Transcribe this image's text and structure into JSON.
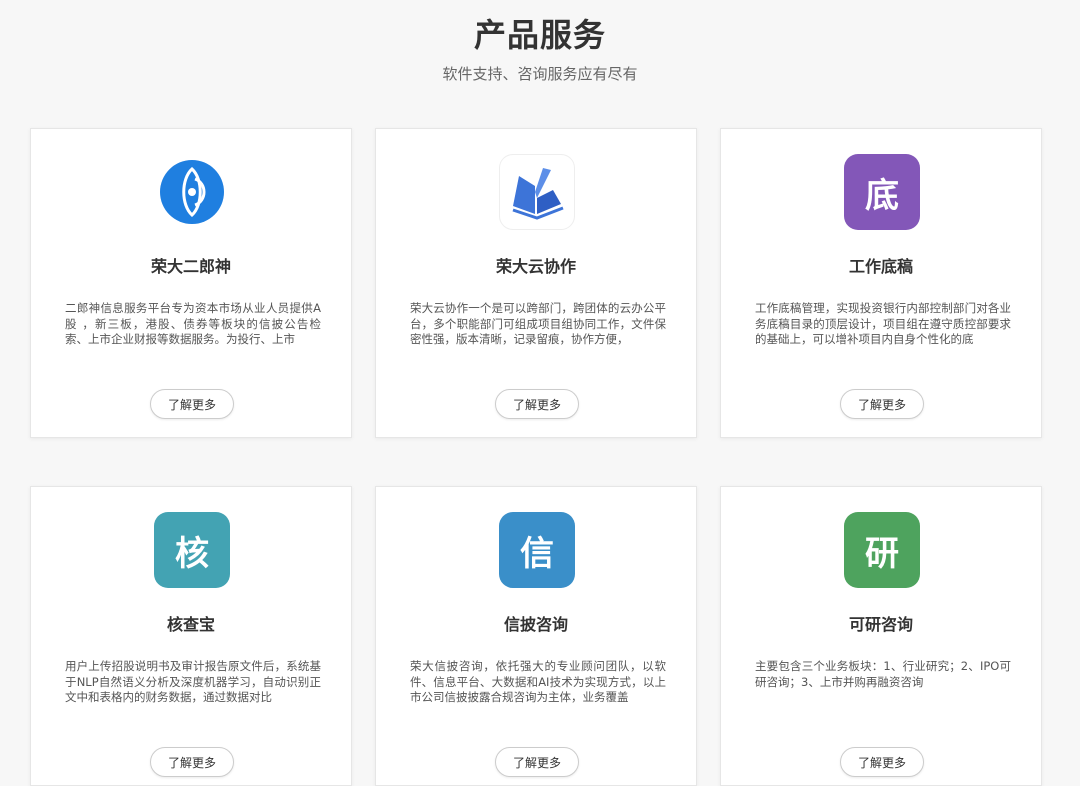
{
  "header": {
    "title": "产品服务",
    "subtitle": "软件支持、咨询服务应有尽有"
  },
  "cards": [
    {
      "name": "荣大二郎神",
      "icon": "eye-logo-icon",
      "desc": "二郎神信息服务平台专为资本市场从业人员提供A股 ，新三板，港股、债券等板块的信披公告检索、上市企业财报等数据服务。为投行、上市",
      "button": "了解更多",
      "color": "#1f7fe0"
    },
    {
      "name": "荣大云协作",
      "icon": "book-wings-icon",
      "desc": "荣大云协作一个是可以跨部门，跨团体的云办公平台，多个职能部门可组成项目组协同工作，文件保密性强，版本清晰，记录留痕，协作方便，",
      "button": "了解更多",
      "color": "#3d74d8"
    },
    {
      "name": "工作底稿",
      "icon_char": "底",
      "icon": "di-char-icon",
      "desc": "工作底稿管理，实现投资银行内部控制部门对各业务底稿目录的顶层设计，项目组在遵守质控部要求的基础上，可以增补项目内自身个性化的底",
      "button": "了解更多",
      "color": "#8357b8"
    },
    {
      "name": "核查宝",
      "icon_char": "核",
      "icon": "he-char-icon",
      "desc": "用户上传招股说明书及审计报告原文件后，系统基于NLP自然语义分析及深度机器学习，自动识别正文中和表格内的财务数据，通过数据对比",
      "button": "了解更多",
      "color": "#43a3b3"
    },
    {
      "name": "信披咨询",
      "icon_char": "信",
      "icon": "xin-char-icon",
      "desc": "荣大信披咨询，依托强大的专业顾问团队，以软件、信息平台、大数据和AI技术为实现方式，以上市公司信披披露合规咨询为主体，业务覆盖",
      "button": "了解更多",
      "color": "#3a8fc9"
    },
    {
      "name": "可研咨询",
      "icon_char": "研",
      "icon": "yan-char-icon",
      "desc": "主要包含三个业务板块：1、行业研究；2、IPO可研咨询；3、上市并购再融资咨询",
      "button": "了解更多",
      "color": "#4ea35e"
    }
  ]
}
